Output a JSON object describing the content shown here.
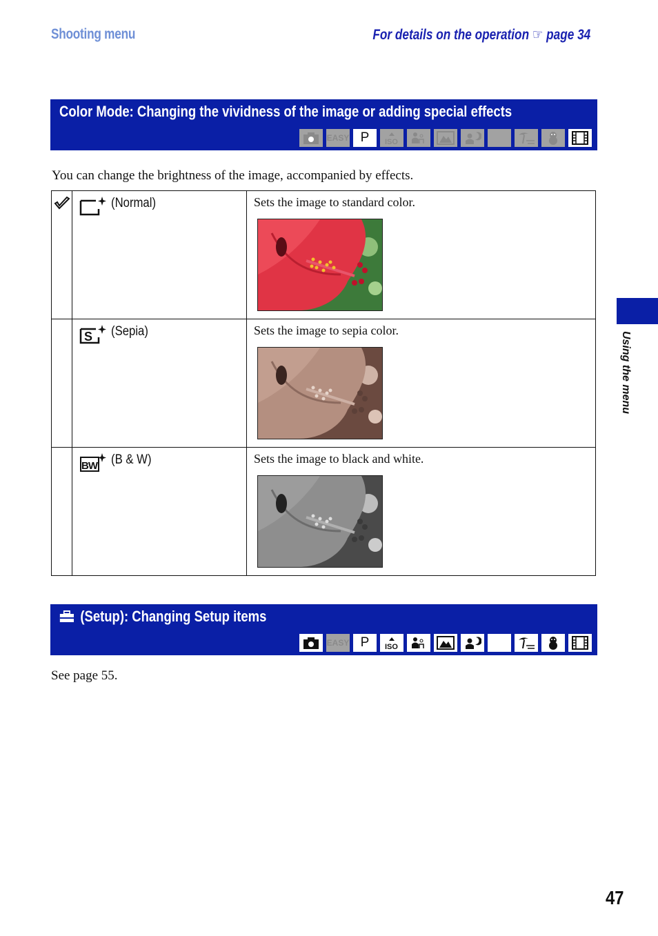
{
  "header": {
    "section": "Shooting menu",
    "reference_text": "For details on the operation",
    "reference_icon": "pointing-hand-icon",
    "reference_page": "page 34"
  },
  "color_mode": {
    "title": "Color Mode: Changing the vividness of the image or adding special effects",
    "modes": [
      {
        "name": "auto-camera",
        "label": "",
        "enabled": false
      },
      {
        "name": "easy",
        "label": "EASY",
        "enabled": false
      },
      {
        "name": "program",
        "label": "P",
        "enabled": true
      },
      {
        "name": "high-iso",
        "label": "ISO",
        "enabled": false
      },
      {
        "name": "soft-snap",
        "label": "",
        "enabled": false
      },
      {
        "name": "landscape",
        "label": "",
        "enabled": false
      },
      {
        "name": "twilight-portrait",
        "label": "",
        "enabled": false
      },
      {
        "name": "twilight",
        "label": "",
        "enabled": false
      },
      {
        "name": "beach",
        "label": "",
        "enabled": false
      },
      {
        "name": "snow",
        "label": "",
        "enabled": false
      },
      {
        "name": "movie",
        "label": "",
        "enabled": true
      }
    ],
    "intro": "You can change the brightness of the image, accompanied by effects.",
    "options": [
      {
        "label": "(Normal)",
        "icon": "normal-color-icon",
        "default": true,
        "description": "Sets the image to standard color.",
        "photo": "hibiscus-color"
      },
      {
        "label": "(Sepia)",
        "icon": "sepia-icon",
        "default": false,
        "description": "Sets the image to sepia color.",
        "photo": "hibiscus-sepia"
      },
      {
        "label": "(B & W)",
        "icon": "bw-icon",
        "default": false,
        "description": "Sets the image to black and white.",
        "photo": "hibiscus-bw"
      }
    ]
  },
  "setup": {
    "title": "(Setup): Changing Setup items",
    "icon": "toolbox-icon",
    "modes_enabled": [
      true,
      false,
      true,
      true,
      true,
      true,
      true,
      true,
      true,
      true,
      true
    ],
    "text": "See page 55."
  },
  "side_tab": {
    "label": "Using the menu"
  },
  "page_number": "47",
  "colors": {
    "banner": "#0a1fa6",
    "section_header": "#6e8fd6",
    "reference": "#1a22b0"
  }
}
